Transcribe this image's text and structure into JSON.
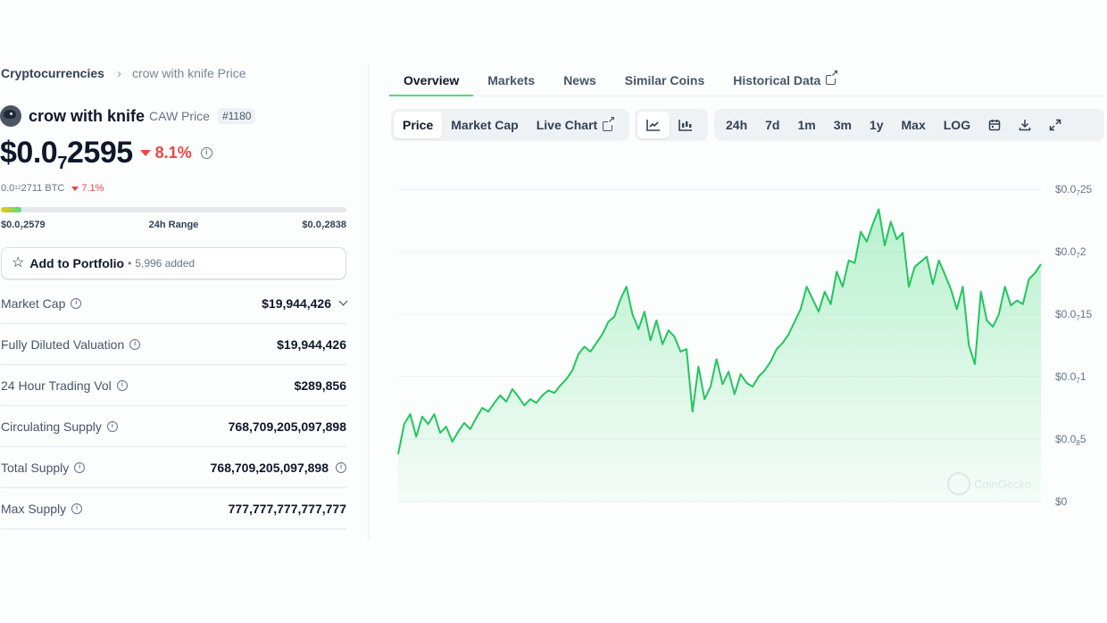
{
  "breadcrumb": {
    "root": "Cryptocurrencies",
    "current": "crow with knife Price"
  },
  "coin": {
    "name": "crow with knife",
    "symbol_label": "CAW Price",
    "rank": "#1180",
    "price_prefix": "$0.0",
    "price_sub": "7",
    "price_suffix": "2595",
    "change_24h": "8.1%",
    "btc_prefix": "0.0",
    "btc_sub": "12",
    "btc_suffix": "2711 BTC",
    "btc_change": "7.1%"
  },
  "range": {
    "low_prefix": "$0.0",
    "low_sub": "7",
    "low_suffix": "2579",
    "label": "24h Range",
    "high_prefix": "$0.0",
    "high_sub": "7",
    "high_suffix": "2838",
    "position": 0.06
  },
  "portfolio": {
    "label": "Add to Portfolio",
    "dot": "•",
    "count": "5,996 added"
  },
  "stats": [
    {
      "label": "Market Cap",
      "value": "$19,944,426"
    },
    {
      "label": "Fully Diluted Valuation",
      "value": "$19,944,426"
    },
    {
      "label": "24 Hour Trading Vol",
      "value": "$289,856"
    },
    {
      "label": "Circulating Supply",
      "value": "768,709,205,097,898"
    },
    {
      "label": "Total Supply",
      "value": "768,709,205,097,898"
    },
    {
      "label": "Max Supply",
      "value": "777,777,777,777,777"
    }
  ],
  "tabs": [
    "Overview",
    "Markets",
    "News",
    "Similar Coins",
    "Historical Data"
  ],
  "active_tab": "Overview",
  "chart_type_buttons": [
    "Price",
    "Market Cap",
    "Live Chart"
  ],
  "active_chart_type": "Price",
  "view_icons": [
    "line-chart-icon",
    "candlestick-icon"
  ],
  "time_ranges": [
    "24h",
    "7d",
    "1m",
    "3m",
    "1y",
    "Max",
    "LOG"
  ],
  "action_icons": [
    "calendar-icon",
    "download-icon",
    "expand-icon"
  ],
  "watermark": "CoinGecko",
  "colors": {
    "accent_green": "#22c55e",
    "down_red": "#ef4444"
  },
  "chart_data": {
    "type": "area",
    "ylabel_ticks": [
      {
        "prefix": "$0.0",
        "sub": "7",
        "suffix": "25",
        "value": 2.5
      },
      {
        "prefix": "$0.0",
        "sub": "7",
        "suffix": "2",
        "value": 2.0
      },
      {
        "prefix": "$0.0",
        "sub": "7",
        "suffix": "15",
        "value": 1.5
      },
      {
        "prefix": "$0.0",
        "sub": "7",
        "suffix": "1",
        "value": 1.0
      },
      {
        "prefix": "$0.0",
        "sub": "8",
        "suffix": "5",
        "value": 0.5
      },
      {
        "prefix": "$0",
        "sub": "",
        "suffix": "",
        "value": 0
      }
    ],
    "ylim": [
      0,
      2.5
    ],
    "y_unit": "1e-8 USD",
    "grid": true,
    "series": [
      {
        "values": [
          0.38,
          0.62,
          0.7,
          0.52,
          0.68,
          0.62,
          0.7,
          0.55,
          0.6,
          0.48,
          0.56,
          0.63,
          0.58,
          0.67,
          0.75,
          0.72,
          0.79,
          0.85,
          0.8,
          0.9,
          0.84,
          0.77,
          0.82,
          0.79,
          0.85,
          0.89,
          0.87,
          0.93,
          0.98,
          1.05,
          1.18,
          1.24,
          1.2,
          1.27,
          1.34,
          1.44,
          1.48,
          1.62,
          1.72,
          1.5,
          1.38,
          1.52,
          1.29,
          1.45,
          1.26,
          1.37,
          1.32,
          1.2,
          1.22,
          0.72,
          1.08,
          0.82,
          0.92,
          1.14,
          0.94,
          1.04,
          0.86,
          1.02,
          0.95,
          0.92,
          1.0,
          1.05,
          1.12,
          1.22,
          1.27,
          1.34,
          1.44,
          1.54,
          1.72,
          1.62,
          1.52,
          1.68,
          1.58,
          1.84,
          1.72,
          1.93,
          1.91,
          2.16,
          2.08,
          2.22,
          2.34,
          2.05,
          2.24,
          2.1,
          2.15,
          1.72,
          1.88,
          1.92,
          1.96,
          1.74,
          1.93,
          1.82,
          1.7,
          1.54,
          1.72,
          1.25,
          1.1,
          1.68,
          1.45,
          1.4,
          1.5,
          1.72,
          1.57,
          1.61,
          1.58,
          1.78,
          1.83,
          1.9
        ]
      }
    ]
  }
}
